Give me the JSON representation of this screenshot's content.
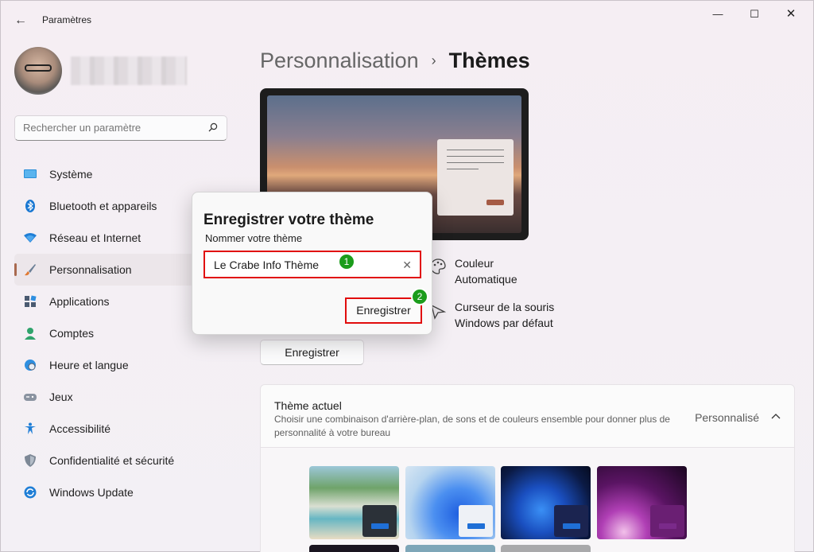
{
  "window": {
    "title": "Paramètres"
  },
  "sidebar": {
    "search_placeholder": "Rechercher un paramètre",
    "items": [
      {
        "label": "Système",
        "icon": "monitor-icon"
      },
      {
        "label": "Bluetooth et appareils",
        "icon": "bluetooth-icon"
      },
      {
        "label": "Réseau et Internet",
        "icon": "wifi-icon"
      },
      {
        "label": "Personnalisation",
        "icon": "brush-icon",
        "active": true
      },
      {
        "label": "Applications",
        "icon": "apps-icon"
      },
      {
        "label": "Comptes",
        "icon": "person-icon"
      },
      {
        "label": "Heure et langue",
        "icon": "globe-clock-icon"
      },
      {
        "label": "Jeux",
        "icon": "gamepad-icon"
      },
      {
        "label": "Accessibilité",
        "icon": "accessibility-icon"
      },
      {
        "label": "Confidentialité et sécurité",
        "icon": "shield-icon"
      },
      {
        "label": "Windows Update",
        "icon": "update-icon"
      }
    ]
  },
  "breadcrumb": {
    "parent": "Personnalisation",
    "separator": "›",
    "current": "Thèmes"
  },
  "properties": {
    "color_label": "Couleur",
    "color_value": "Automatique",
    "cursor_label": "Curseur de la souris",
    "cursor_value": "Windows par défaut"
  },
  "save_button": "Enregistrer",
  "current_theme": {
    "title": "Thème actuel",
    "description": "Choisir une combinaison d'arrière-plan, de sons et de couleurs ensemble pour donner plus de personnalité à votre bureau",
    "value": "Personnalisé"
  },
  "dialog": {
    "title": "Enregistrer votre thème",
    "label": "Nommer votre thème",
    "input_value": "Le Crabe Info Thème",
    "save_label": "Enregistrer",
    "badge1": "1",
    "badge2": "2"
  },
  "colors": {
    "accent": "#a9694f",
    "highlight": "#e10d0d",
    "badge": "#1b9c1b"
  }
}
